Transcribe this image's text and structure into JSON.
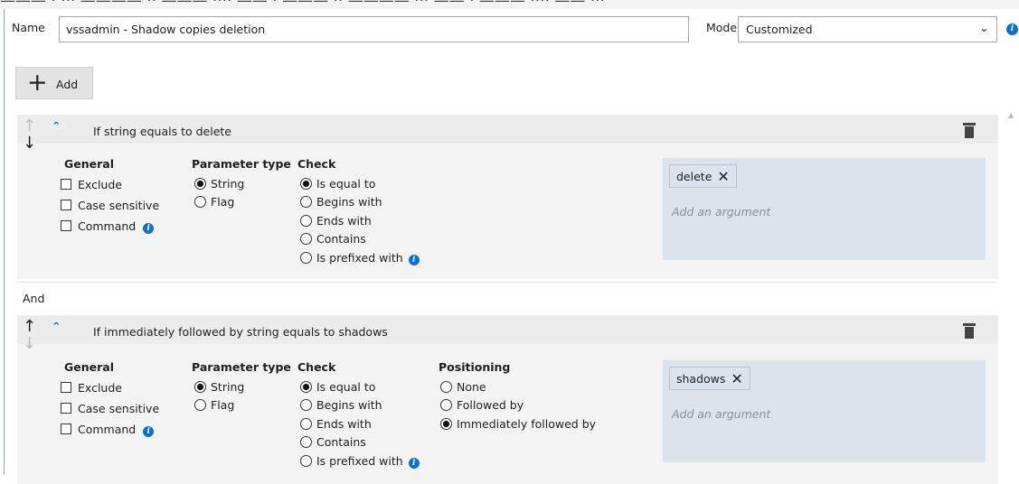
{
  "name_field": {
    "label": "Name",
    "value": "vssadmin - Shadow copies deletion"
  },
  "mode_field": {
    "label": "Mode",
    "value": "Customized"
  },
  "icons": {
    "info": "info-icon",
    "trash": "trash-icon",
    "up": "arrow-up-icon",
    "down": "arrow-down-icon",
    "collapse": "chevron-up-icon",
    "dropdown": "chevron-down-icon",
    "plus": "plus-icon",
    "remove": "close-icon"
  },
  "add_button": {
    "label": "Add"
  },
  "connector": "And",
  "colors": {
    "argument_box": "#dbe3ec",
    "rule_bg": "#f3f3f3",
    "info_blue": "#0b6fd3",
    "caret_blue": "#1f5fae"
  },
  "rules": [
    {
      "title": "If string equals to delete",
      "general": {
        "header": "General",
        "options": [
          {
            "label": "Exclude",
            "checked": false
          },
          {
            "label": "Case sensitive",
            "checked": false
          },
          {
            "label": "Command",
            "checked": false
          }
        ]
      },
      "parameter_type": {
        "header": "Parameter type",
        "options": [
          {
            "label": "String",
            "selected": true
          },
          {
            "label": "Flag",
            "selected": false
          }
        ]
      },
      "check": {
        "header": "Check",
        "options": [
          {
            "label": "Is equal to",
            "selected": true
          },
          {
            "label": "Begins with",
            "selected": false
          },
          {
            "label": "Ends with",
            "selected": false
          },
          {
            "label": "Contains",
            "selected": false
          },
          {
            "label": "Is prefixed with",
            "selected": false
          }
        ]
      },
      "arguments": {
        "values": [
          "delete"
        ],
        "placeholder": "Add an argument"
      }
    },
    {
      "title": "If immediately followed by string equals to shadows",
      "general": {
        "header": "General",
        "options": [
          {
            "label": "Exclude",
            "checked": false
          },
          {
            "label": "Case sensitive",
            "checked": false
          },
          {
            "label": "Command",
            "checked": false
          }
        ]
      },
      "parameter_type": {
        "header": "Parameter type",
        "options": [
          {
            "label": "String",
            "selected": true
          },
          {
            "label": "Flag",
            "selected": false
          }
        ]
      },
      "check": {
        "header": "Check",
        "options": [
          {
            "label": "Is equal to",
            "selected": true
          },
          {
            "label": "Begins with",
            "selected": false
          },
          {
            "label": "Ends with",
            "selected": false
          },
          {
            "label": "Contains",
            "selected": false
          },
          {
            "label": "Is prefixed with",
            "selected": false
          }
        ]
      },
      "positioning": {
        "header": "Positioning",
        "options": [
          {
            "label": "None",
            "selected": false
          },
          {
            "label": "Followed by",
            "selected": false
          },
          {
            "label": "Immediately followed by",
            "selected": true
          }
        ]
      },
      "arguments": {
        "values": [
          "shadows"
        ],
        "placeholder": "Add an argument"
      }
    }
  ]
}
